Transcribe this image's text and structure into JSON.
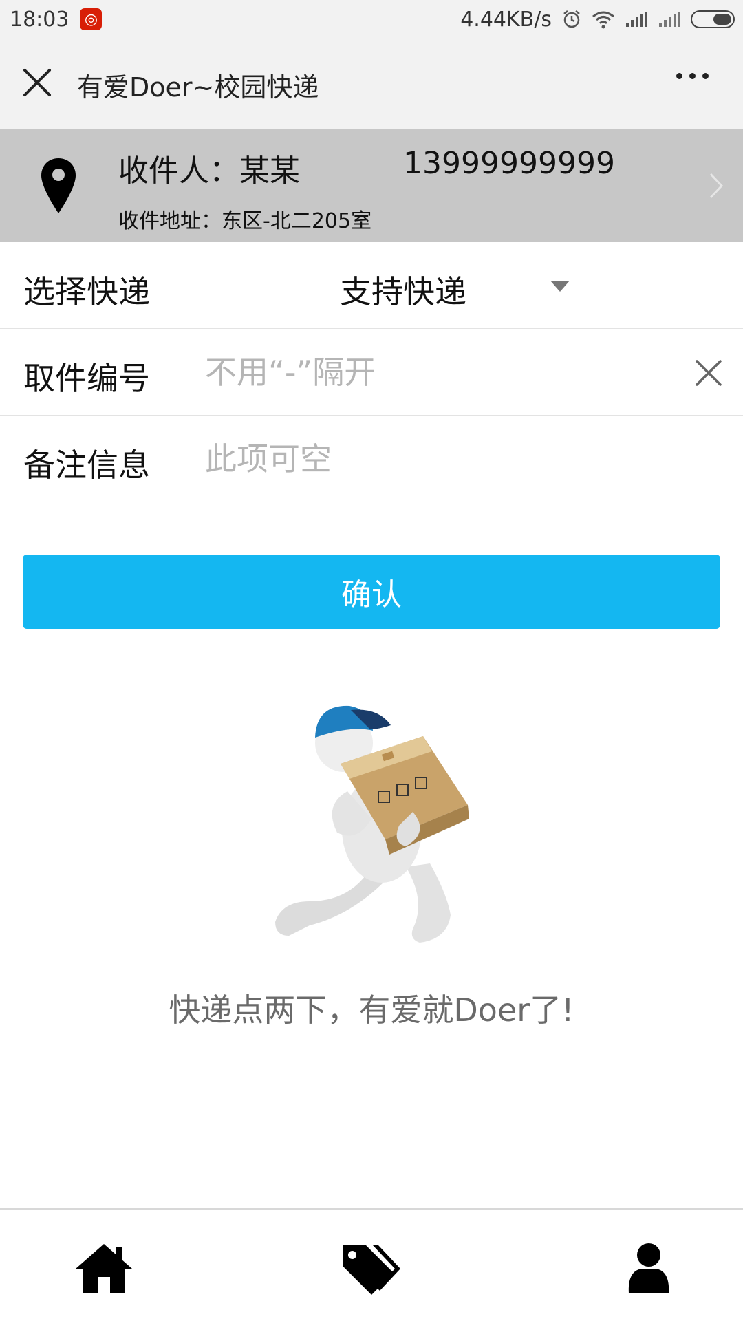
{
  "status_bar": {
    "time": "18:03",
    "network_speed": "4.44KB/s",
    "app_badge_icon": "netease-music-icon",
    "icons": [
      "alarm-icon",
      "wifi-icon",
      "signal-icon",
      "signal-icon",
      "battery-icon"
    ]
  },
  "nav": {
    "title": "有爱Doer~校园快递",
    "close_icon": "close-icon",
    "more_icon": "more-icon"
  },
  "address": {
    "recipient_label": "收件人：某某",
    "phone": "13999999999",
    "address_label": "收件地址：东区-北二205室",
    "icon": "location-pin-icon"
  },
  "form": {
    "express": {
      "label": "选择快递",
      "selected": "支持快递"
    },
    "pickup_code": {
      "label": "取件编号",
      "value": "",
      "placeholder": "不用“-”隔开"
    },
    "note": {
      "label": "备注信息",
      "value": "",
      "placeholder": "此项可空"
    },
    "confirm_label": "确认"
  },
  "slogan": "快递点两下，有爱就Doer了!",
  "tabbar": {
    "items": [
      {
        "icon": "home-icon"
      },
      {
        "icon": "tags-icon"
      },
      {
        "icon": "user-icon"
      }
    ]
  },
  "colors": {
    "accent": "#14b7f1",
    "address_bg": "#c7c7c7",
    "navbar_bg": "#f2f2f2"
  }
}
